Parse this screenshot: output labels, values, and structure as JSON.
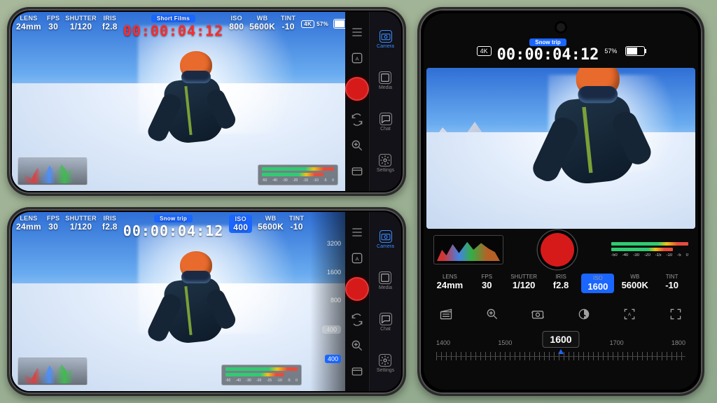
{
  "phone1": {
    "project": "Short Films",
    "timecode": "00:00:04:12",
    "resolution": "4K",
    "battery_pct": "57%",
    "stats": {
      "lens": {
        "label": "LENS",
        "value": "24mm"
      },
      "fps": {
        "label": "FPS",
        "value": "30"
      },
      "shutter": {
        "label": "SHUTTER",
        "value": "1/120"
      },
      "iris": {
        "label": "IRIS",
        "value": "f2.8"
      },
      "iso": {
        "label": "ISO",
        "value": "800"
      },
      "wb": {
        "label": "WB",
        "value": "5600K"
      },
      "tint": {
        "label": "TINT",
        "value": "-10"
      }
    },
    "audio_scale": [
      "-50",
      "-40",
      "-30",
      "-20",
      "-15",
      "-10",
      "-5",
      "0"
    ],
    "nav": [
      "Camera",
      "Media",
      "Chat",
      "Settings"
    ]
  },
  "phone2": {
    "project": "Snow trip",
    "timecode": "00:00:04:12",
    "stats": {
      "lens": {
        "label": "LENS",
        "value": "24mm"
      },
      "fps": {
        "label": "FPS",
        "value": "30"
      },
      "shutter": {
        "label": "SHUTTER",
        "value": "1/120"
      },
      "iris": {
        "label": "IRIS",
        "value": "f2.8"
      },
      "iso": {
        "label": "ISO",
        "value": "400"
      },
      "wb": {
        "label": "WB",
        "value": "5600K"
      },
      "tint": {
        "label": "TINT",
        "value": "-10"
      }
    },
    "iso_ruler": {
      "ticks": [
        "3200",
        "1600",
        "800",
        "400"
      ],
      "active": "400",
      "current": "400"
    },
    "nav": [
      "Camera",
      "Media",
      "Chat",
      "Settings"
    ]
  },
  "phone3": {
    "project": "Snow trip",
    "timecode": "00:00:04:12",
    "resolution": "4K",
    "battery_pct": "57%",
    "audio_scale": [
      "-50",
      "-40",
      "-30",
      "-20",
      "-15",
      "-10",
      "-5",
      "0"
    ],
    "stats": {
      "lens": {
        "label": "LENS",
        "value": "24mm"
      },
      "fps": {
        "label": "FPS",
        "value": "30"
      },
      "shutter": {
        "label": "SHUTTER",
        "value": "1/120"
      },
      "iris": {
        "label": "IRIS",
        "value": "f2.8"
      },
      "iso": {
        "label": "ISO",
        "value": "1600"
      },
      "wb": {
        "label": "WB",
        "value": "5600K"
      },
      "tint": {
        "label": "TINT",
        "value": "-10"
      }
    },
    "ruler": {
      "labels": [
        "1400",
        "1500",
        "1600",
        "1700",
        "1800"
      ],
      "active": "1600"
    }
  },
  "tool_icons": [
    "slate",
    "zoom-in",
    "flip-camera",
    "exposure",
    "focus-auto",
    "fullscreen"
  ],
  "toolstrip": [
    "menu",
    "brightness",
    "focus",
    "flip"
  ]
}
